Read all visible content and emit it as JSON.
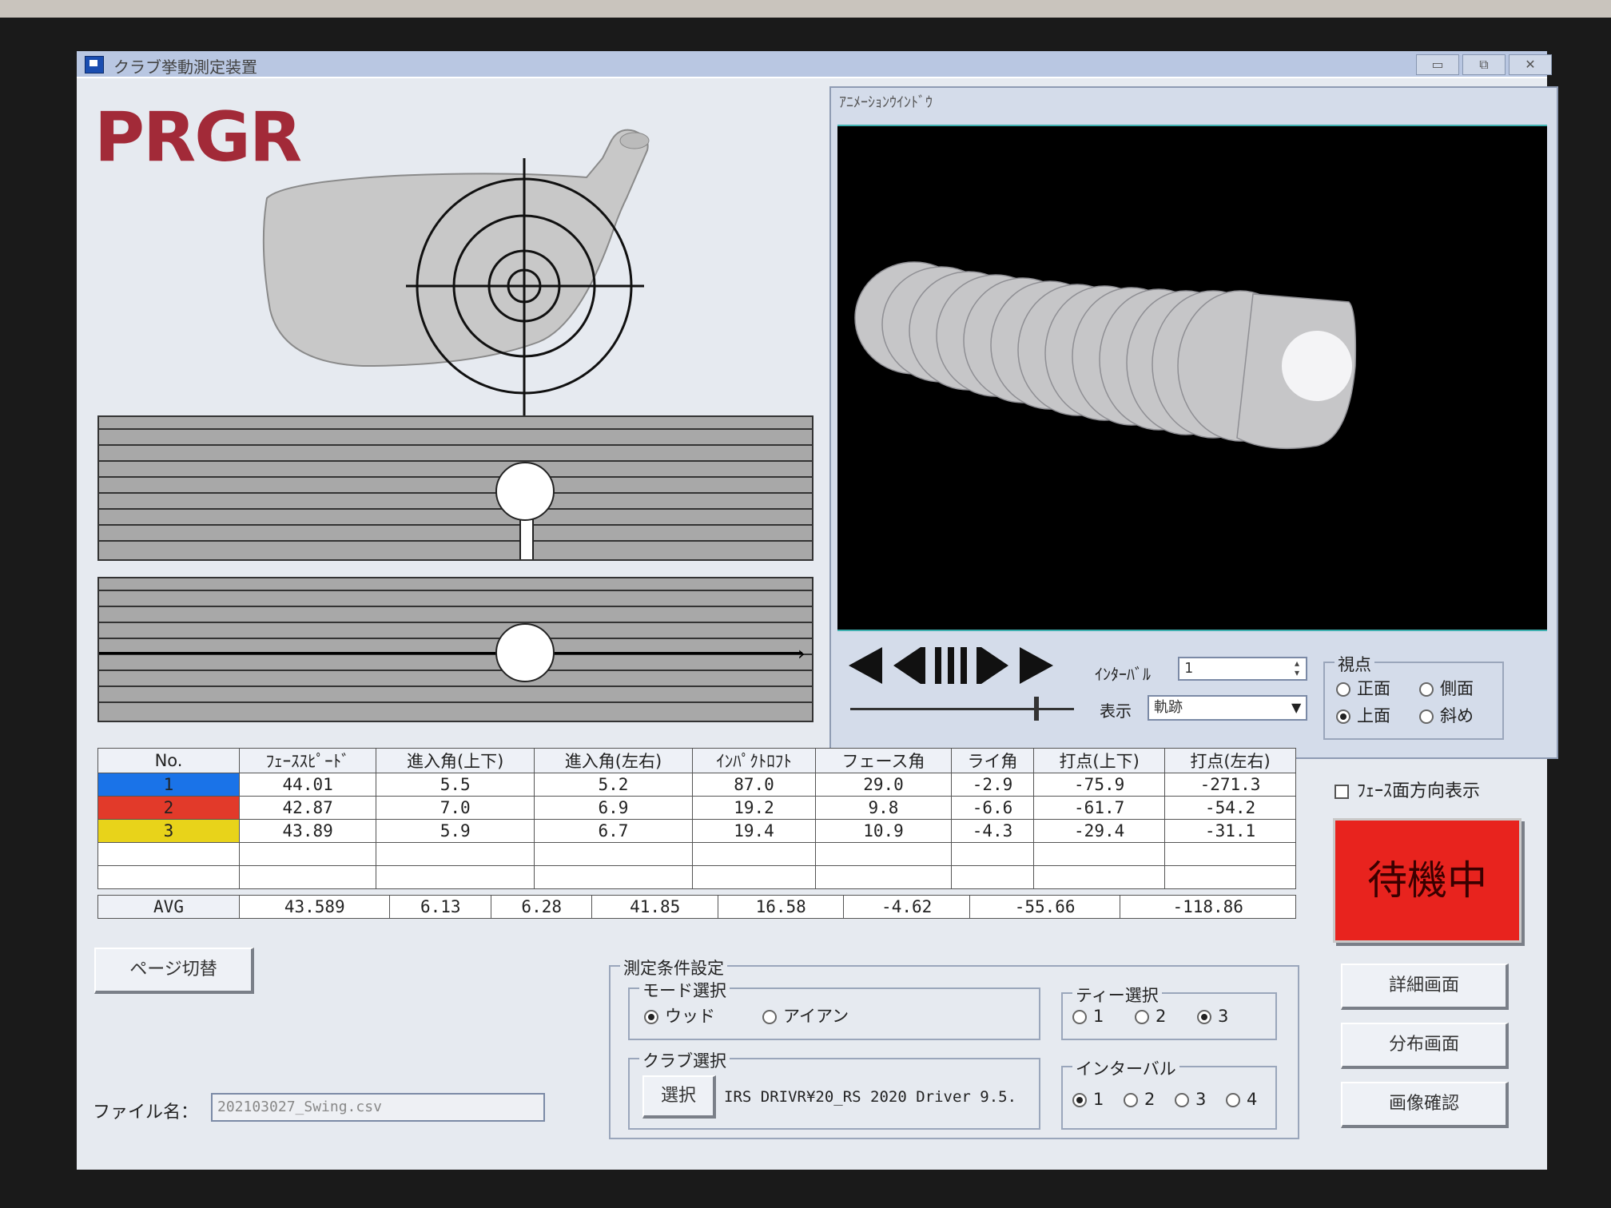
{
  "window": {
    "title": "クラブ挙動測定装置",
    "min_icon": "minimize-icon",
    "max_icon": "restore-icon",
    "close_icon": "close-icon"
  },
  "logo": {
    "text_pr": "PR",
    "text_gr": "GR"
  },
  "animation": {
    "title": "ｱﾆﾒｰｼｮﾝｳｲﾝﾄﾞｳ",
    "interval_label": "ｲﾝﾀｰﾊﾞﾙ",
    "interval_value": "1",
    "display_label": "表示",
    "display_value": "軌跡",
    "viewpoint": {
      "legend": "視点",
      "options": [
        "正面",
        "側面",
        "上面",
        "斜め"
      ],
      "selected": "上面"
    }
  },
  "table": {
    "headers": [
      "No.",
      "ﾌｪｰｽｽﾋﾟｰﾄﾞ",
      "進入角(上下)",
      "進入角(左右)",
      "ｲﾝﾊﾟｸﾄﾛﾌﾄ",
      "フェース角",
      "ライ角",
      "打点(上下)",
      "打点(左右)"
    ],
    "rows": [
      {
        "no": "1",
        "color": "#1a73e8",
        "values": [
          "44.01",
          "5.5",
          "5.2",
          "87.0",
          "29.0",
          "-2.9",
          "-75.9",
          "-271.3"
        ]
      },
      {
        "no": "2",
        "color": "#e23a2a",
        "values": [
          "42.87",
          "7.0",
          "6.9",
          "19.2",
          "9.8",
          "-6.6",
          "-61.7",
          "-54.2"
        ]
      },
      {
        "no": "3",
        "color": "#e8d31a",
        "values": [
          "43.89",
          "5.9",
          "6.7",
          "19.4",
          "10.9",
          "-4.3",
          "-29.4",
          "-31.1"
        ]
      }
    ],
    "avg_label": "AVG",
    "avg_values": [
      "43.589",
      "6.13",
      "6.28",
      "41.85",
      "16.58",
      "-4.62",
      "-55.66",
      "-118.86"
    ]
  },
  "face_direction_label": "ﾌｪｰｽ面方向表示",
  "status_label": "待機中",
  "buttons": {
    "page_switch": "ページ切替",
    "detail": "詳細画面",
    "distribution": "分布画面",
    "image_check": "画像確認",
    "select": "選択"
  },
  "conditions": {
    "legend": "測定条件設定",
    "mode": {
      "legend": "モード選択",
      "options": [
        "ウッド",
        "アイアン"
      ],
      "selected": "ウッド"
    },
    "tee": {
      "legend": "ティー選択",
      "options": [
        "1",
        "2",
        "3"
      ],
      "selected": "3"
    },
    "club": {
      "legend": "クラブ選択",
      "value": "IRS DRIVR¥20_RS 2020 Driver 9.5."
    },
    "interval": {
      "legend": "インターバル",
      "options": [
        "1",
        "2",
        "3",
        "4"
      ],
      "selected": "1"
    }
  },
  "file": {
    "label": "ファイル名：",
    "value": "202103027_Swing.csv"
  }
}
